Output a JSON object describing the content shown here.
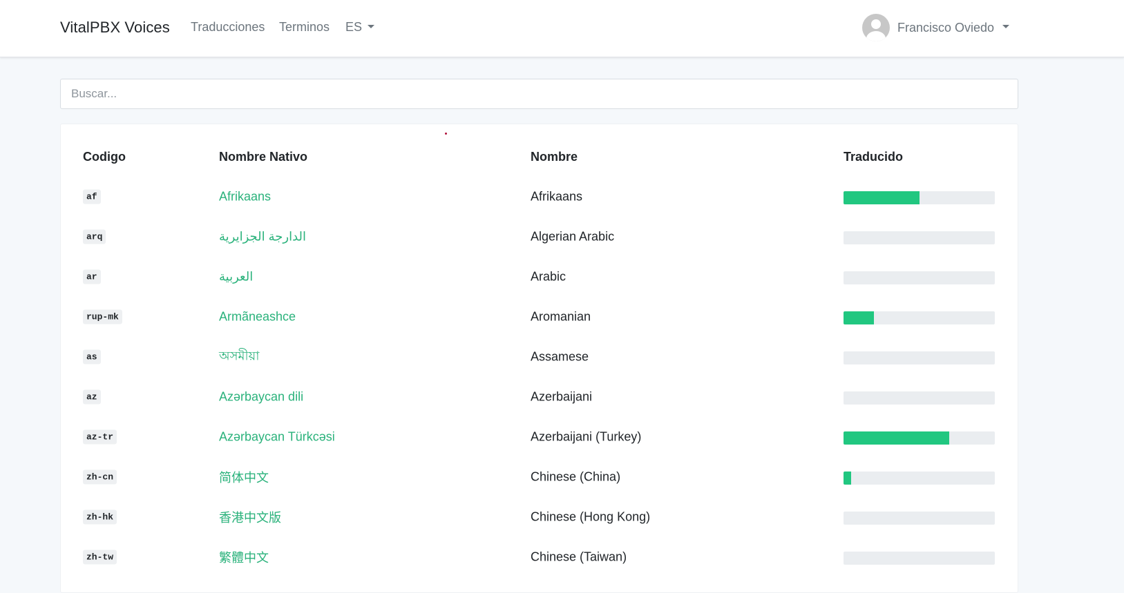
{
  "navbar": {
    "brand": "VitalPBX Voices",
    "links": [
      "Traducciones",
      "Terminos"
    ],
    "language": "ES",
    "user_name": "Francisco Oviedo"
  },
  "search": {
    "placeholder": "Buscar..."
  },
  "table": {
    "headers": [
      "Codigo",
      "Nombre Nativo",
      "Nombre",
      "Traducido"
    ],
    "rows": [
      {
        "code": "af",
        "native": "Afrikaans",
        "name": "Afrikaans",
        "progress": 0.5
      },
      {
        "code": "arq",
        "native": "الدارجة الجزايرية",
        "name": "Algerian Arabic",
        "progress": 0
      },
      {
        "code": "ar",
        "native": "العربية",
        "name": "Arabic",
        "progress": 0
      },
      {
        "code": "rup-mk",
        "native": "Armãneashce",
        "name": "Aromanian",
        "progress": 0.2
      },
      {
        "code": "as",
        "native": "অসমীয়া",
        "name": "Assamese",
        "progress": 0
      },
      {
        "code": "az",
        "native": "Azərbaycan dili",
        "name": "Azerbaijani",
        "progress": 0
      },
      {
        "code": "az-tr",
        "native": "Azərbaycan Türkcəsi",
        "name": "Azerbaijani (Turkey)",
        "progress": 0.7
      },
      {
        "code": "zh-cn",
        "native": "简体中文",
        "name": "Chinese (China)",
        "progress": 0.05
      },
      {
        "code": "zh-hk",
        "native": "香港中文版",
        "name": "Chinese (Hong Kong)",
        "progress": 0
      },
      {
        "code": "zh-tw",
        "native": "繁體中文",
        "name": "Chinese (Taiwan)",
        "progress": 0
      }
    ]
  },
  "colors": {
    "accent": "#2ab27b",
    "progress_fill": "#21c780",
    "progress_track": "#eaedf0",
    "background": "#f5f8fb"
  },
  "icons": {
    "avatar": "user-avatar-icon",
    "dropdown": "caret-down-icon"
  }
}
